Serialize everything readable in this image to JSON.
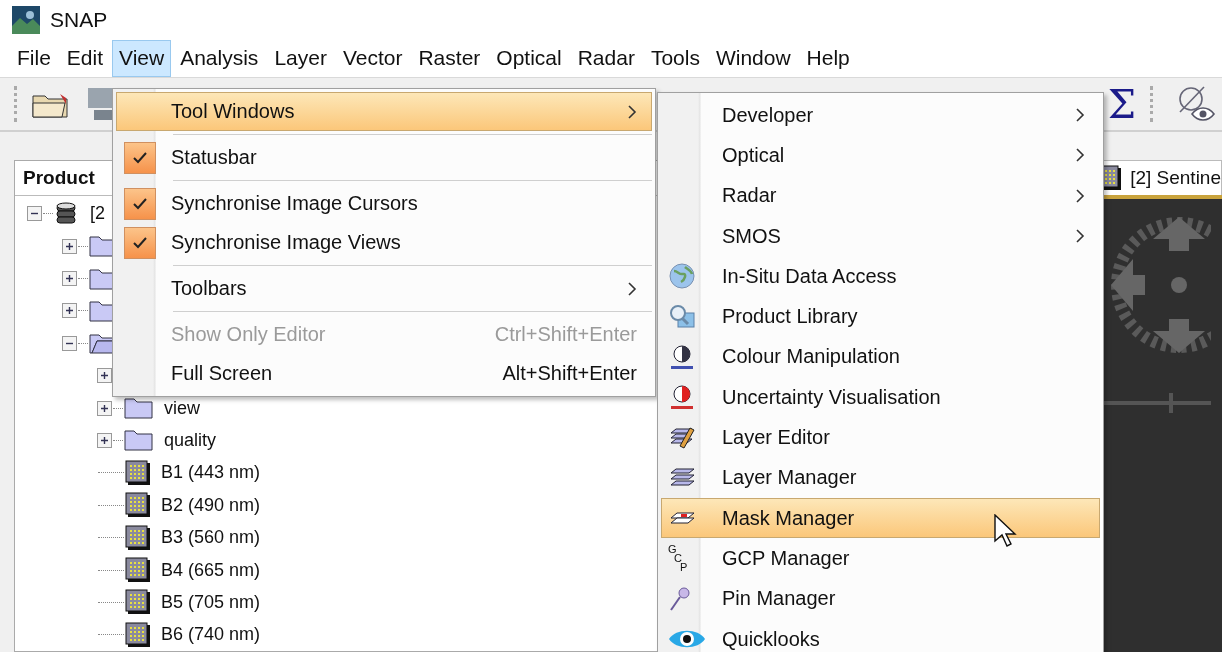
{
  "app": {
    "title": "SNAP"
  },
  "menubar": [
    {
      "label": "File",
      "selected": false
    },
    {
      "label": "Edit",
      "selected": false
    },
    {
      "label": "View",
      "selected": true
    },
    {
      "label": "Analysis",
      "selected": false
    },
    {
      "label": "Layer",
      "selected": false
    },
    {
      "label": "Vector",
      "selected": false
    },
    {
      "label": "Raster",
      "selected": false
    },
    {
      "label": "Optical",
      "selected": false
    },
    {
      "label": "Radar",
      "selected": false
    },
    {
      "label": "Tools",
      "selected": false
    },
    {
      "label": "Window",
      "selected": false
    },
    {
      "label": "Help",
      "selected": false
    }
  ],
  "toolbar": {
    "glyph_button": "Σ"
  },
  "product_explorer": {
    "title": "Product",
    "tree": [
      {
        "kind": "product",
        "label": "[2",
        "expanded": true,
        "children": [
          {
            "kind": "folder",
            "expanded": false
          },
          {
            "kind": "folder",
            "expanded": false
          },
          {
            "kind": "folder",
            "expanded": false
          },
          {
            "kind": "folder",
            "expanded": true,
            "children": [
              {
                "kind": "folder",
                "expanded": false
              },
              {
                "kind": "folder",
                "label": "view",
                "expanded": false
              },
              {
                "kind": "folder",
                "label": "quality",
                "expanded": false
              },
              {
                "kind": "band",
                "label": "B1 (443 nm)"
              },
              {
                "kind": "band",
                "label": "B2 (490 nm)"
              },
              {
                "kind": "band",
                "label": "B3 (560 nm)"
              },
              {
                "kind": "band",
                "label": "B4 (665 nm)"
              },
              {
                "kind": "band",
                "label": "B5 (705 nm)"
              },
              {
                "kind": "band",
                "label": "B6 (740 nm)"
              }
            ]
          }
        ]
      }
    ]
  },
  "editor_tab": {
    "label": "[2] Sentine",
    "selected": true
  },
  "view_menu": {
    "items": [
      {
        "kind": "submenu",
        "label": "Tool Windows",
        "selected": true
      },
      {
        "kind": "separator"
      },
      {
        "kind": "check",
        "label": "Statusbar",
        "checked": true,
        "selected": false
      },
      {
        "kind": "separator"
      },
      {
        "kind": "check",
        "label": "Synchronise Image Cursors",
        "checked": true,
        "selected": false
      },
      {
        "kind": "check",
        "label": "Synchronise Image Views",
        "checked": true,
        "selected": false
      },
      {
        "kind": "separator"
      },
      {
        "kind": "submenu",
        "label": "Toolbars",
        "selected": false
      },
      {
        "kind": "separator"
      },
      {
        "kind": "command",
        "label": "Show Only Editor",
        "shortcut": "Ctrl+Shift+Enter",
        "disabled": true,
        "selected": false
      },
      {
        "kind": "command",
        "label": "Full Screen",
        "shortcut": "Alt+Shift+Enter",
        "disabled": false,
        "selected": false
      }
    ]
  },
  "tool_windows_menu": {
    "items": [
      {
        "kind": "submenu",
        "label": "Developer",
        "selected": false
      },
      {
        "kind": "submenu",
        "label": "Optical",
        "selected": false
      },
      {
        "kind": "submenu",
        "label": "Radar",
        "selected": false
      },
      {
        "kind": "submenu",
        "label": "SMOS",
        "selected": false
      },
      {
        "kind": "tool",
        "label": "In-Situ Data Access",
        "selected": false
      },
      {
        "kind": "tool",
        "label": "Product Library",
        "selected": false
      },
      {
        "kind": "tool",
        "label": "Colour Manipulation",
        "selected": false
      },
      {
        "kind": "tool",
        "label": "Uncertainty Visualisation",
        "selected": false
      },
      {
        "kind": "tool",
        "label": "Layer Editor",
        "selected": false
      },
      {
        "kind": "tool",
        "label": "Layer Manager",
        "selected": false
      },
      {
        "kind": "tool",
        "label": "Mask Manager",
        "selected": true
      },
      {
        "kind": "tool",
        "label": "GCP Manager",
        "icon_text": "GCP",
        "selected": false
      },
      {
        "kind": "tool",
        "label": "Pin Manager",
        "selected": false
      },
      {
        "kind": "tool",
        "label": "Quicklooks",
        "selected": false
      }
    ]
  }
}
